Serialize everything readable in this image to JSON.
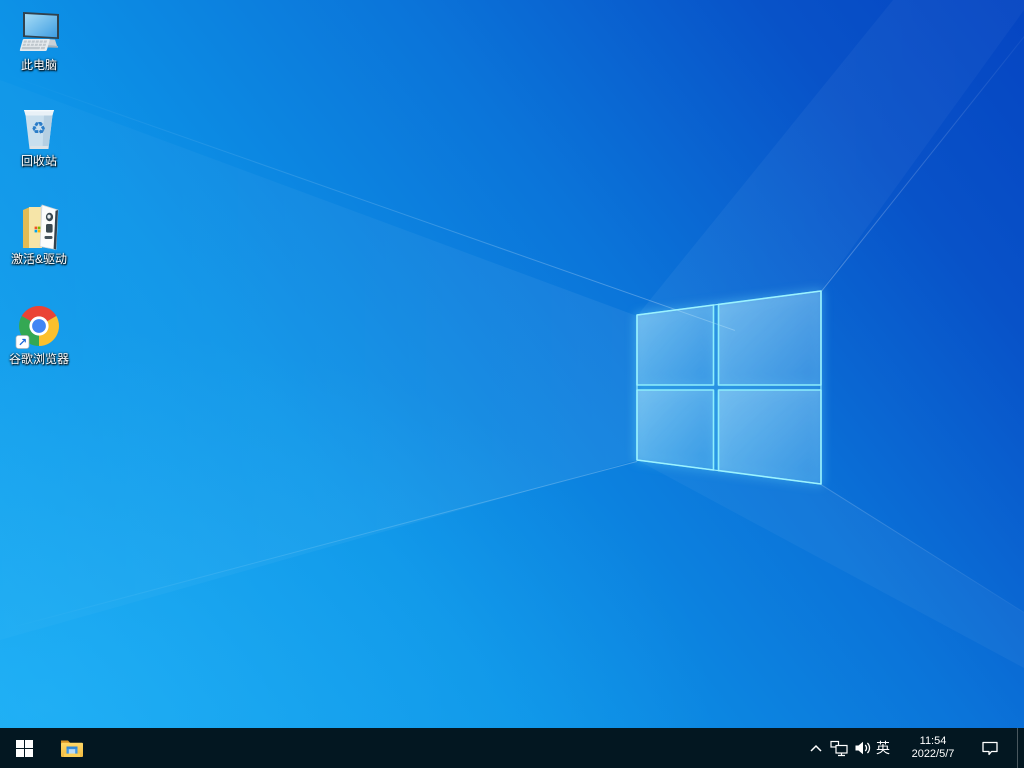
{
  "desktop": {
    "icons": [
      {
        "label": "此电脑"
      },
      {
        "label": "回收站"
      },
      {
        "label": "激活&驱动"
      },
      {
        "label": "谷歌浏览器"
      }
    ]
  },
  "taskbar": {
    "tray": {
      "ime": "英",
      "time": "11:54",
      "date": "2022/5/7"
    }
  },
  "icons": {
    "recycle_glyph": "♻",
    "shortcut_glyph": "↗"
  },
  "colors": {
    "wallpaper_bottom_left": "#16a8f2",
    "wallpaper_top_left": "#0d9dee",
    "wallpaper_top_right": "#0545c2",
    "logo_edge": "#8deefc",
    "logo_pane_fill": "rgba(200,240,255,0.30)",
    "taskbar_background": "#031721",
    "taskbar_text": "#ffffff",
    "chrome_red": "#ea4335",
    "chrome_yellow": "#fbc02d",
    "chrome_green": "#34a853",
    "chrome_blue": "#4285f4",
    "folder_yellow": "#f7c948",
    "explorer_tray_blue": "#4da4ea"
  }
}
